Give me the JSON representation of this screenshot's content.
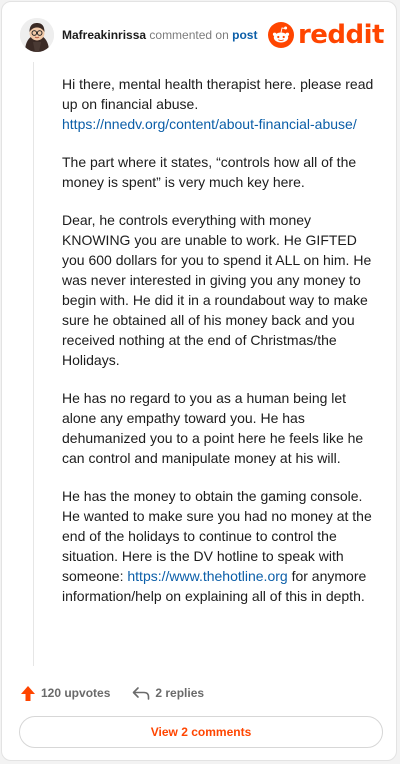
{
  "header": {
    "username": "Mafreakinrissa",
    "commented_on": "commented on",
    "post_link": "post",
    "logo_text": "reddit"
  },
  "comment": {
    "p1_text": "Hi there, mental health therapist here. please read up on financial abuse.",
    "p1_link": "https://nnedv.org/content/about-financial-abuse/",
    "p2": "The part where it states, “controls how all of the money is spent” is very much key here.",
    "p3": "Dear, he controls everything with money KNOWING you are unable to work. He GIFTED you 600 dollars for you to spend it ALL on him. He was never interested in giving you any money to begin with. He did it in a roundabout way to make sure he obtained all of his money back and you received nothing at the end of Christmas/the Holidays.",
    "p4": "He has no regard to you as a human being let alone any empathy toward you. He has dehumanized you to a point here he feels like he can control and manipulate money at his will.",
    "p5_before": "He has the money to obtain the gaming console. He wanted to make sure you had no money at the end of the holidays to continue to control the situation. Here is the DV hotline to speak with someone:",
    "p5_link": "https://www.thehotline.org",
    "p5_after": "for anymore information/help on explaining all of this in depth."
  },
  "actions": {
    "upvotes": "120 upvotes",
    "replies": "2 replies",
    "view_comments": "View 2 comments"
  },
  "colors": {
    "brand": "#ff4500",
    "link": "#0b5ea8",
    "muted": "#7c7c7c"
  },
  "icons": [
    "avatar",
    "reddit-logo-icon",
    "upvote-arrow-icon",
    "reply-arrow-icon"
  ]
}
